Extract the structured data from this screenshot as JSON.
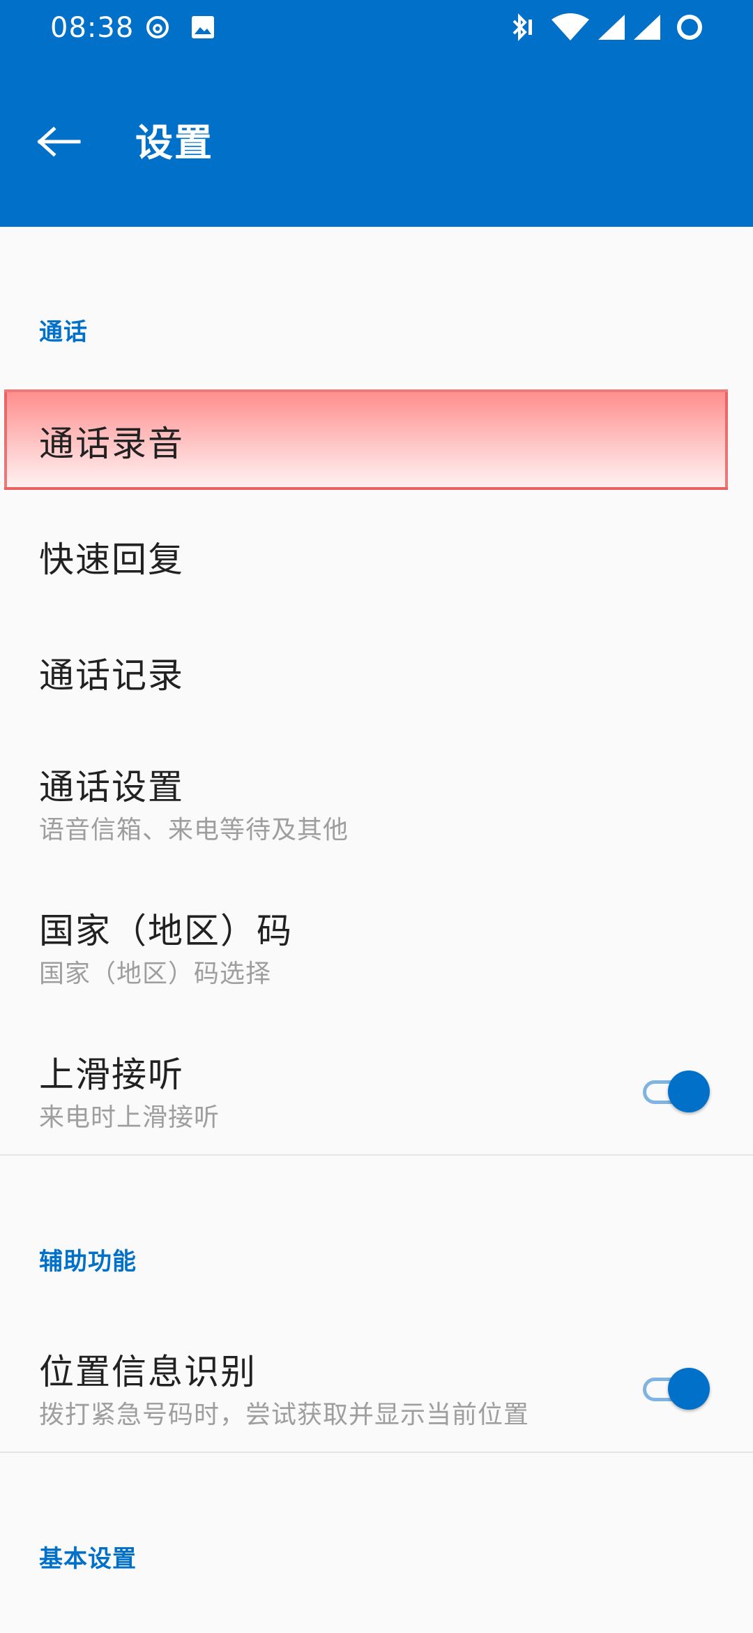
{
  "status_bar": {
    "time": "08:38",
    "icons_left": [
      "netease-cloud-music-icon",
      "gallery-image-icon"
    ],
    "icons_right": [
      "bluetooth-icon",
      "wifi-icon",
      "signal-icon",
      "signal-icon",
      "battery-ring-icon"
    ]
  },
  "toolbar": {
    "back_icon": "arrow-back-icon",
    "title": "设置"
  },
  "sections": {
    "call": {
      "header": "通话",
      "items": {
        "call_recording": {
          "title": "通话录音"
        },
        "quick_reply": {
          "title": "快速回复"
        },
        "call_log": {
          "title": "通话记录"
        },
        "call_settings": {
          "title": "通话设置",
          "subtitle": "语音信箱、来电等待及其他"
        },
        "country_code": {
          "title": "国家（地区）码",
          "subtitle": "国家（地区）码选择"
        },
        "swipe_answer": {
          "title": "上滑接听",
          "subtitle": "来电时上滑接听",
          "enabled": true
        }
      }
    },
    "accessibility": {
      "header": "辅助功能",
      "items": {
        "location_id": {
          "title": "位置信息识别",
          "subtitle": "拨打紧急号码时，尝试获取并显示当前位置",
          "enabled": true
        }
      }
    },
    "basic": {
      "header": "基本设置"
    }
  },
  "colors": {
    "primary": "#0070c9",
    "highlight": "#ff8e8e",
    "background": "#fafafa",
    "text_primary": "#212121",
    "text_secondary": "#9e9e9e"
  }
}
